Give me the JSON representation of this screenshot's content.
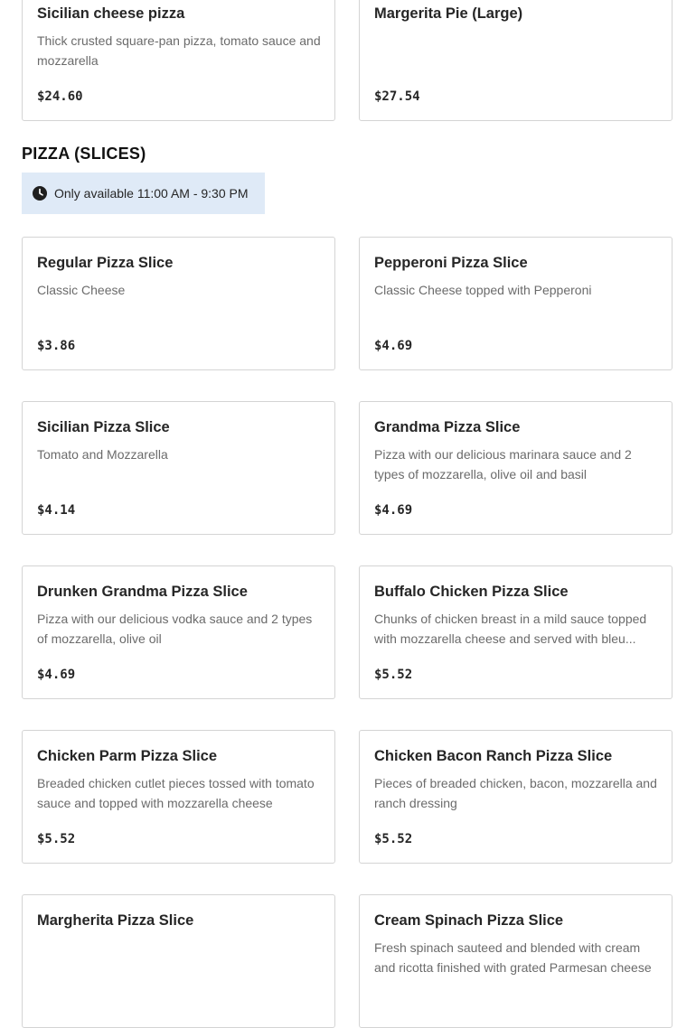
{
  "top_items": [
    {
      "name": "Sicilian cheese pizza",
      "description": "Thick crusted square-pan pizza, tomato sauce and mozzarella",
      "price": "$24.60"
    },
    {
      "name": "Margerita Pie (Large)",
      "description": "",
      "price": "$27.54"
    }
  ],
  "section": {
    "title": "PIZZA (SLICES)",
    "availability": "Only available 11:00 AM - 9:30 PM",
    "availability_icon": "clock-icon"
  },
  "items": [
    {
      "name": "Regular Pizza Slice",
      "description": "Classic Cheese",
      "price": "$3.86"
    },
    {
      "name": "Pepperoni Pizza Slice",
      "description": "Classic Cheese topped with Pepperoni",
      "price": "$4.69"
    },
    {
      "name": "Sicilian Pizza Slice",
      "description": "Tomato and Mozzarella",
      "price": "$4.14"
    },
    {
      "name": "Grandma Pizza Slice",
      "description": "Pizza with our delicious marinara sauce and 2 types of mozzarella, olive oil and basil",
      "price": "$4.69"
    },
    {
      "name": "Drunken Grandma Pizza Slice",
      "description": "Pizza with our delicious vodka sauce and 2 types of mozzarella, olive oil",
      "price": "$4.69"
    },
    {
      "name": "Buffalo Chicken Pizza Slice",
      "description": "Chunks of chicken breast in a mild sauce topped with mozzarella cheese and served with bleu...",
      "price": "$5.52"
    },
    {
      "name": "Chicken Parm Pizza Slice",
      "description": "Breaded chicken cutlet pieces tossed with tomato sauce and topped with mozzarella cheese",
      "price": "$5.52"
    },
    {
      "name": "Chicken Bacon Ranch Pizza Slice",
      "description": "Pieces of breaded chicken, bacon, mozzarella and ranch dressing",
      "price": "$5.52"
    },
    {
      "name": "Margherita Pizza Slice",
      "description": "",
      "price": ""
    },
    {
      "name": "Cream Spinach Pizza Slice",
      "description": "Fresh spinach sauteed and blended with cream and ricotta finished with grated Parmesan cheese",
      "price": ""
    }
  ],
  "colors": {
    "availability_bg": "#dfeaf7",
    "card_border": "#d4d4d4",
    "description_text": "#6b6b6b"
  }
}
